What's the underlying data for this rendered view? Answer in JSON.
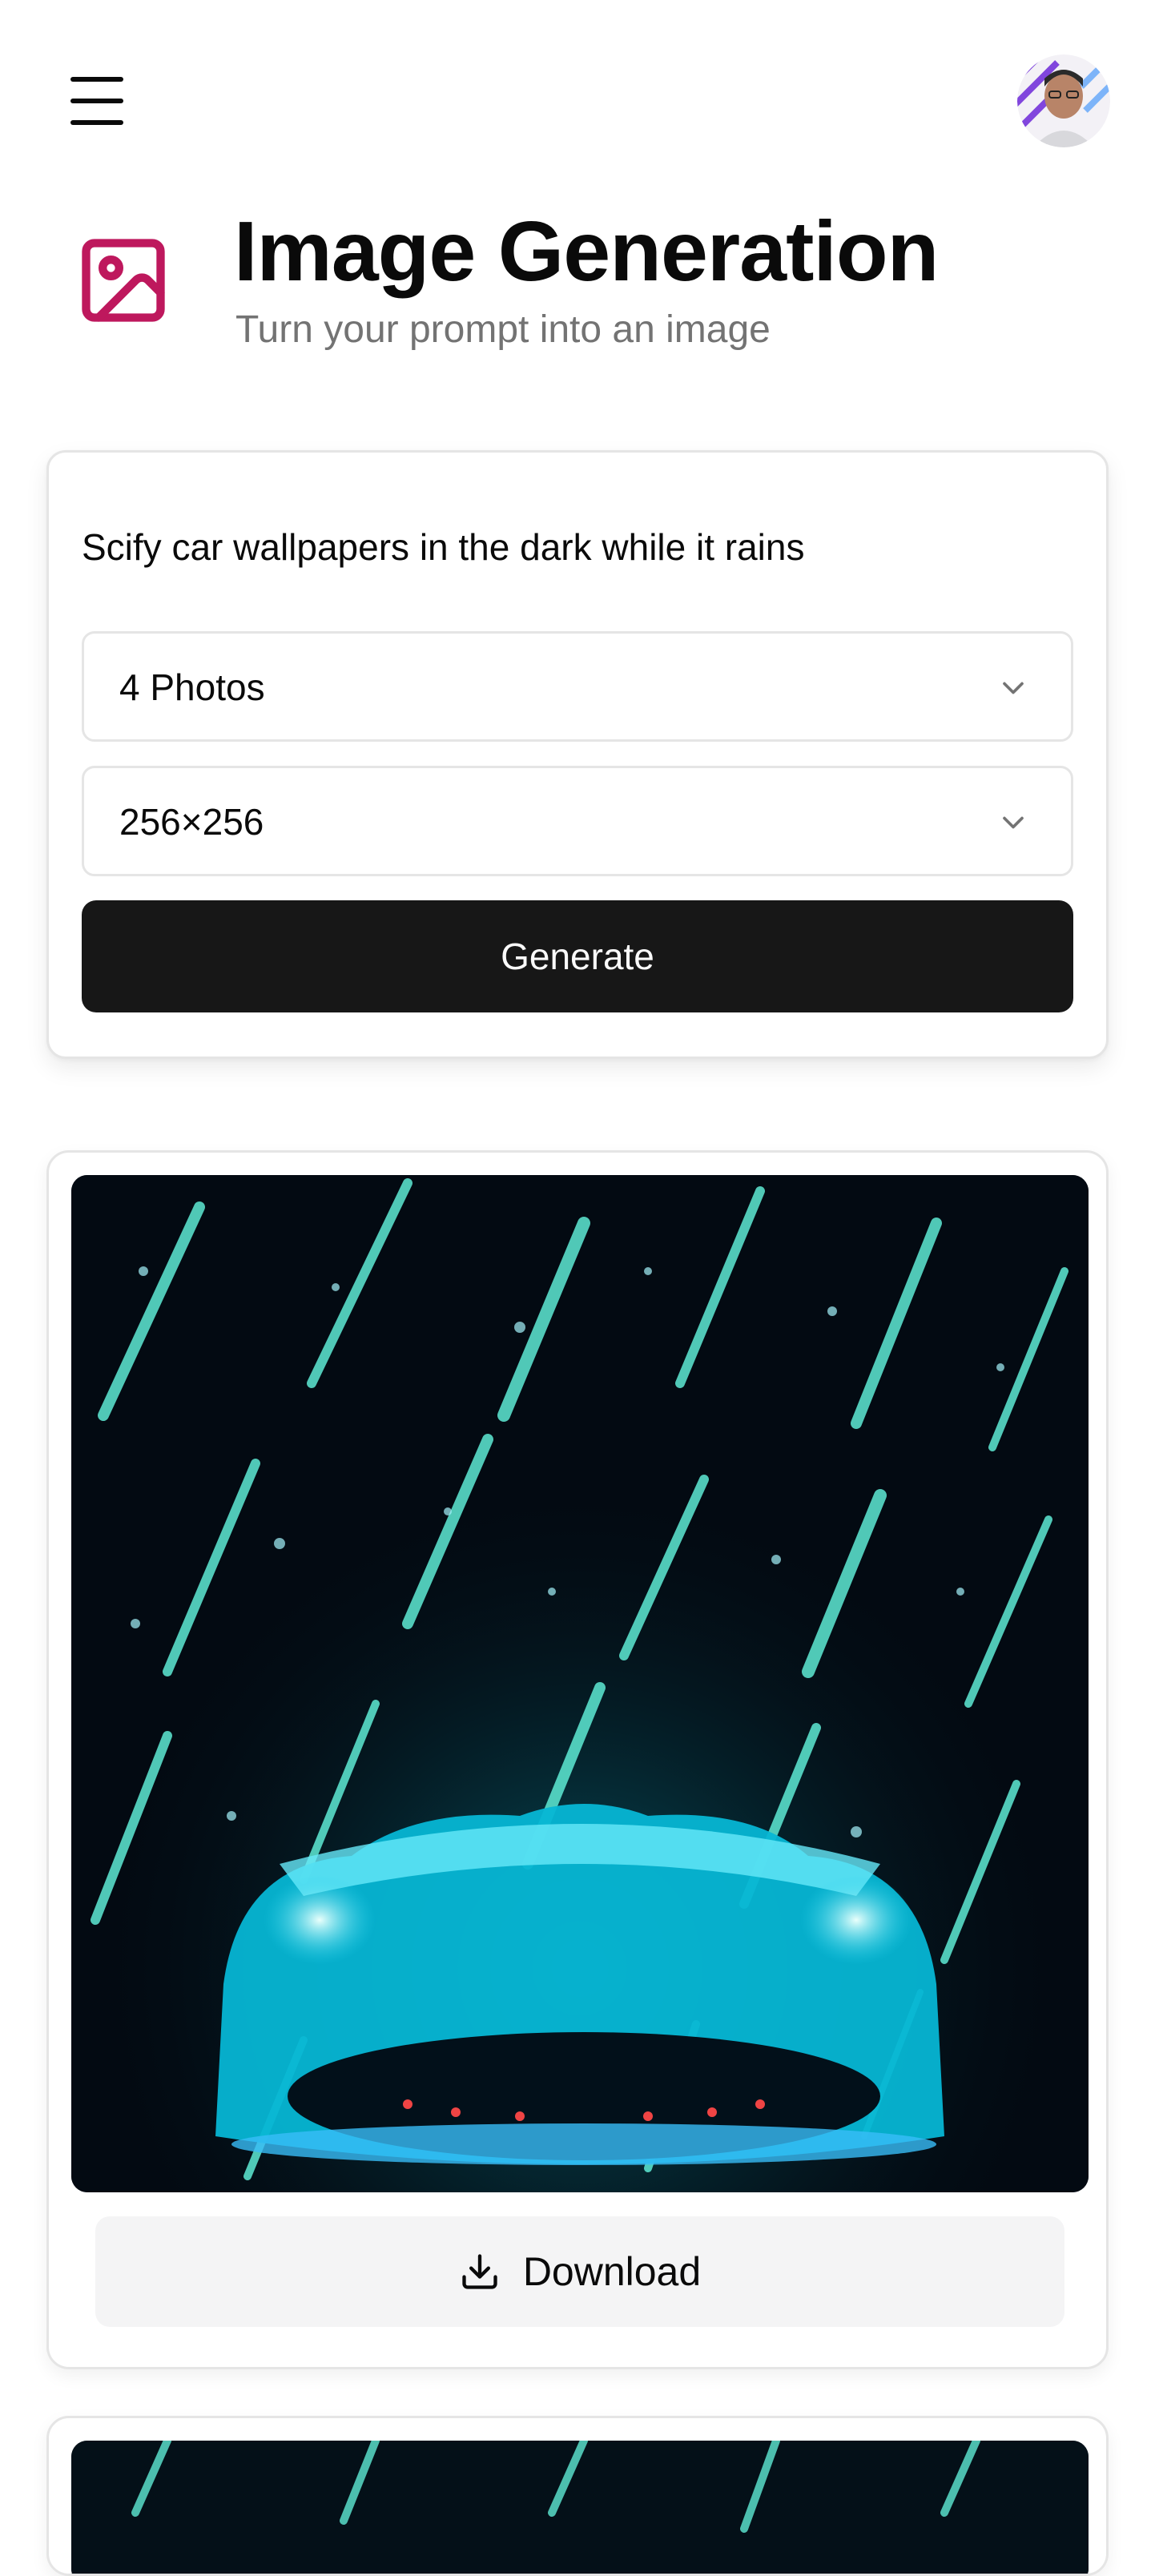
{
  "header": {
    "menu_icon": "hamburger-menu-icon",
    "avatar_icon": "user-avatar"
  },
  "page": {
    "icon": "image-icon",
    "accent_color": "#be185d",
    "title": "Image Generation",
    "subtitle": "Turn your prompt into an image"
  },
  "form": {
    "prompt": "Scify car wallpapers in the dark while it rains",
    "amount": "4 Photos",
    "resolution": "256×256",
    "generate_label": "Generate"
  },
  "results": {
    "download_label": "Download",
    "download_icon": "download-icon"
  }
}
